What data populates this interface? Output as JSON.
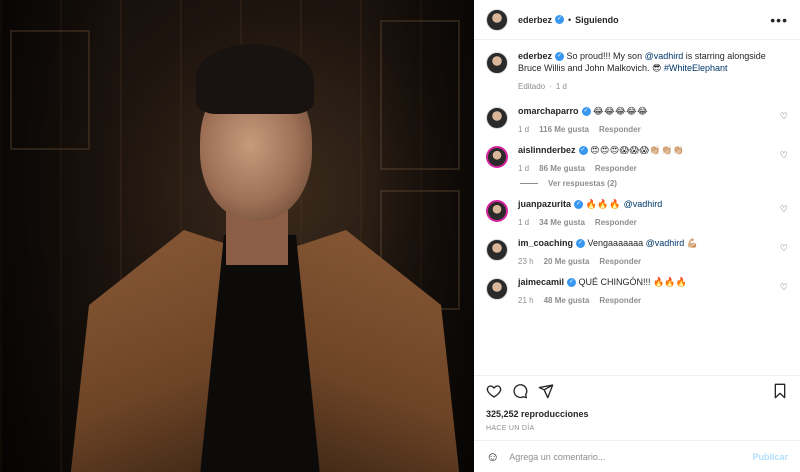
{
  "post": {
    "author": "ederbez",
    "follow_dot": "•",
    "follow_status": "Siguiendo",
    "more_icon": "more-horizontal-icon",
    "caption": {
      "user": "ederbez",
      "text_before": "So proud!!! My son ",
      "mention": "@vadhird",
      "text_after": " is starring alongside Bruce Willis and John Malkovich. 😎 ",
      "hashtag": "#WhiteElephant",
      "edited": "Editado",
      "sep": "·",
      "age": "1 d"
    },
    "comments": [
      {
        "user": "omarchaparro",
        "text": "😂😂😂😂😂",
        "age": "1 d",
        "likes": "116 Me gusta",
        "reply": "Responder"
      },
      {
        "user": "aislinnderbez",
        "text": "😍😍😍😱😱😱👏🏼👏🏼👏🏼",
        "age": "1 d",
        "likes": "86 Me gusta",
        "reply": "Responder",
        "view_replies": "Ver respuestas (2)"
      },
      {
        "user": "juanpazurita",
        "text": "🔥🔥🔥 ",
        "mention": "@vadhird",
        "age": "1 d",
        "likes": "34 Me gusta",
        "reply": "Responder"
      },
      {
        "user": "im_coaching",
        "text": "Vengaaaaaaa ",
        "mention": "@vadhird",
        "text_after": " 💪🏼",
        "age": "23 h",
        "likes": "20 Me gusta",
        "reply": "Responder"
      },
      {
        "user": "jaimecamil",
        "text": "QUÉ CHINGÓN!!! 🔥🔥🔥",
        "age": "21 h",
        "likes": "48 Me gusta",
        "reply": "Responder"
      }
    ],
    "views": "325,252 reproducciones",
    "date": "HACE UN DÍA",
    "compose": {
      "placeholder": "Agrega un comentario...",
      "publish": "Publicar"
    }
  },
  "colors": {
    "verified": "#3897f0",
    "link": "#00376b",
    "muted": "#8e8e8e",
    "publish_disabled": "#b2dffc"
  }
}
